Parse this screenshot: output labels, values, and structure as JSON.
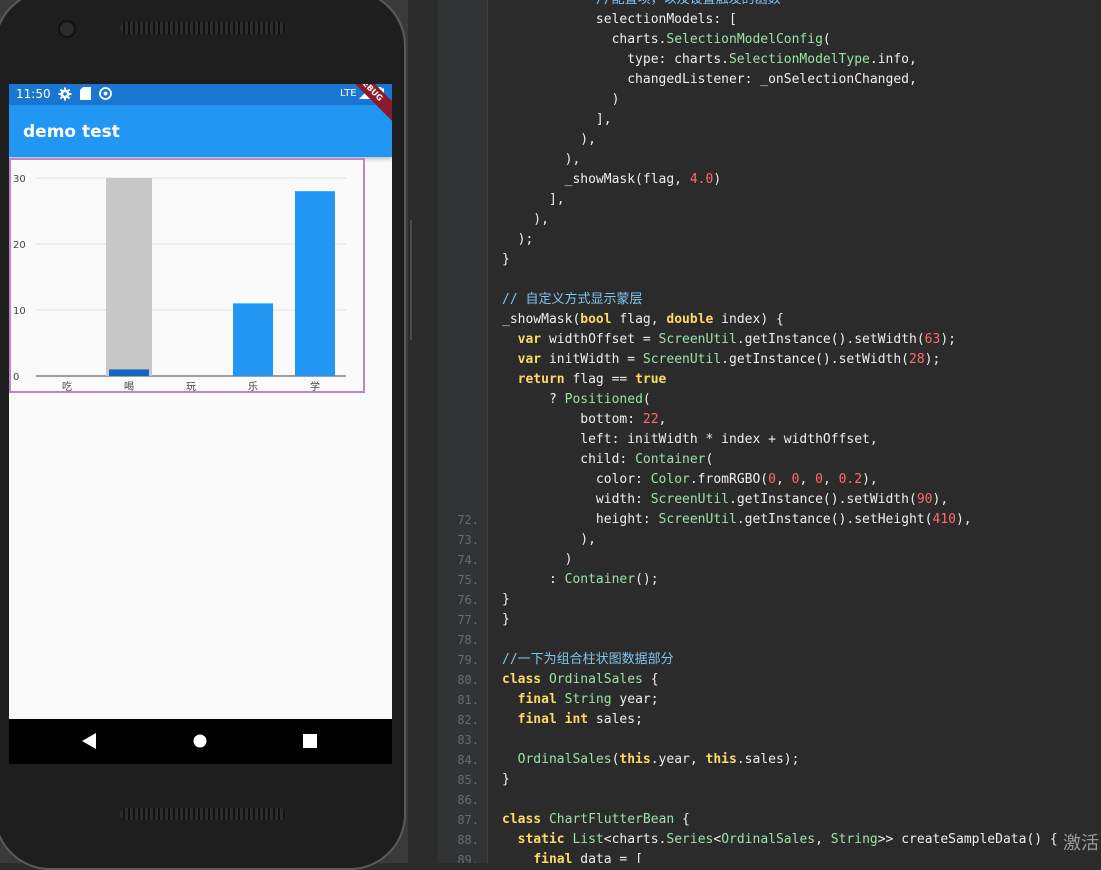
{
  "phone": {
    "status_time": "11:50",
    "network": "LTE",
    "app_title": "demo test",
    "debug_banner": "DEBUG",
    "colors": {
      "status_bar": "#1976d2",
      "app_bar": "#2196f3",
      "bar": "#2196f3",
      "highlight": "#c8c8c8"
    }
  },
  "chart_data": {
    "type": "bar",
    "categories": [
      "吃",
      "喝",
      "玩",
      "乐",
      "学"
    ],
    "values": [
      0,
      1,
      0,
      11,
      28
    ],
    "ylim": [
      0,
      30
    ],
    "yticks": [
      "0",
      "10",
      "20",
      "30"
    ],
    "grid": true,
    "highlight_index": 1,
    "highlight_value": 30
  },
  "emulator_panel": {
    "title_buttons": [
      "−",
      "×"
    ],
    "buttons": [
      "power-icon",
      "volume-up-icon",
      "volume-down-icon",
      "rotate-left-icon",
      "rotate-right-icon",
      "camera-icon",
      "zoom-icon",
      "back-icon",
      "home-icon",
      "overview-icon",
      "more-icon"
    ]
  },
  "code": {
    "lines": [
      {
        "n": "",
        "t": [
          [
            "cm",
            "            //配置项，以及设置触发的函数"
          ]
        ]
      },
      {
        "n": "",
        "t": [
          [
            "pl",
            "            selectionModels: ["
          ]
        ]
      },
      {
        "n": "",
        "t": [
          [
            "pl",
            "              charts."
          ],
          [
            "ty",
            "SelectionModelConfig"
          ],
          [
            "pl",
            "("
          ]
        ]
      },
      {
        "n": "",
        "t": [
          [
            "pl",
            "                type: charts."
          ],
          [
            "ty",
            "SelectionModelType"
          ],
          [
            "pl",
            ".info,"
          ]
        ]
      },
      {
        "n": "",
        "t": [
          [
            "pl",
            "                changedListener: _onSelectionChanged,"
          ]
        ]
      },
      {
        "n": "",
        "t": [
          [
            "pl",
            "              )"
          ]
        ]
      },
      {
        "n": "",
        "t": [
          [
            "pl",
            "            ],"
          ]
        ]
      },
      {
        "n": "",
        "t": [
          [
            "pl",
            "          ),"
          ]
        ]
      },
      {
        "n": "",
        "t": [
          [
            "pl",
            "        ),"
          ]
        ]
      },
      {
        "n": "",
        "t": [
          [
            "pl",
            "        _showMask(flag, "
          ],
          [
            "num",
            "4.0"
          ],
          [
            "pl",
            ")"
          ]
        ]
      },
      {
        "n": "",
        "t": [
          [
            "pl",
            "      ],"
          ]
        ]
      },
      {
        "n": "",
        "t": [
          [
            "pl",
            "    ),"
          ]
        ]
      },
      {
        "n": "",
        "t": [
          [
            "pl",
            "  );"
          ]
        ]
      },
      {
        "n": "",
        "t": [
          [
            "pl",
            "}"
          ]
        ]
      },
      {
        "n": "",
        "t": [
          [
            "pl",
            ""
          ]
        ]
      },
      {
        "n": "",
        "t": [
          [
            "cm",
            "// 自定义方式显示蒙层"
          ]
        ]
      },
      {
        "n": "",
        "t": [
          [
            "pl",
            "_showMask("
          ],
          [
            "kw",
            "bool"
          ],
          [
            "pl",
            " flag, "
          ],
          [
            "kw",
            "double"
          ],
          [
            "pl",
            " index) {"
          ]
        ]
      },
      {
        "n": "",
        "t": [
          [
            "pl",
            "  "
          ],
          [
            "kw",
            "var"
          ],
          [
            "pl",
            " widthOffset = "
          ],
          [
            "ty",
            "ScreenUtil"
          ],
          [
            "pl",
            ".getInstance().setWidth("
          ],
          [
            "num",
            "63"
          ],
          [
            "pl",
            ");"
          ]
        ]
      },
      {
        "n": "",
        "t": [
          [
            "pl",
            "  "
          ],
          [
            "kw",
            "var"
          ],
          [
            "pl",
            " initWidth = "
          ],
          [
            "ty",
            "ScreenUtil"
          ],
          [
            "pl",
            ".getInstance().setWidth("
          ],
          [
            "num",
            "28"
          ],
          [
            "pl",
            ");"
          ]
        ]
      },
      {
        "n": "",
        "t": [
          [
            "pl",
            "  "
          ],
          [
            "kw",
            "return"
          ],
          [
            "pl",
            " flag == "
          ],
          [
            "kw",
            "true"
          ]
        ]
      },
      {
        "n": "",
        "t": [
          [
            "pl",
            "      ? "
          ],
          [
            "ty",
            "Positioned"
          ],
          [
            "pl",
            "("
          ]
        ]
      },
      {
        "n": "",
        "t": [
          [
            "pl",
            "          bottom: "
          ],
          [
            "num",
            "22"
          ],
          [
            "pl",
            ","
          ]
        ]
      },
      {
        "n": "",
        "t": [
          [
            "pl",
            "          left: initWidth * index + widthOffset,"
          ]
        ]
      },
      {
        "n": "",
        "t": [
          [
            "pl",
            "          child: "
          ],
          [
            "ty",
            "Container"
          ],
          [
            "pl",
            "("
          ]
        ]
      },
      {
        "n": "",
        "t": [
          [
            "pl",
            "            color: "
          ],
          [
            "ty",
            "Color"
          ],
          [
            "pl",
            ".fromRGBO("
          ],
          [
            "num",
            "0"
          ],
          [
            "pl",
            ", "
          ],
          [
            "num",
            "0"
          ],
          [
            "pl",
            ", "
          ],
          [
            "num",
            "0"
          ],
          [
            "pl",
            ", "
          ],
          [
            "num",
            "0.2"
          ],
          [
            "pl",
            "),"
          ]
        ]
      },
      {
        "n": "",
        "t": [
          [
            "pl",
            "            width: "
          ],
          [
            "ty",
            "ScreenUtil"
          ],
          [
            "pl",
            ".getInstance().setWidth("
          ],
          [
            "num",
            "90"
          ],
          [
            "pl",
            "),"
          ]
        ]
      },
      {
        "n": "72.",
        "t": [
          [
            "pl",
            "            height: "
          ],
          [
            "ty",
            "ScreenUtil"
          ],
          [
            "pl",
            ".getInstance().setHeight("
          ],
          [
            "num",
            "410"
          ],
          [
            "pl",
            "),"
          ]
        ]
      },
      {
        "n": "73.",
        "t": [
          [
            "pl",
            "          ),"
          ]
        ]
      },
      {
        "n": "74.",
        "t": [
          [
            "pl",
            "        )"
          ]
        ]
      },
      {
        "n": "75.",
        "t": [
          [
            "pl",
            "      : "
          ],
          [
            "ty",
            "Container"
          ],
          [
            "pl",
            "();"
          ]
        ]
      },
      {
        "n": "76.",
        "t": [
          [
            "pl",
            "}"
          ]
        ]
      },
      {
        "n": "77.",
        "t": [
          [
            "pl",
            "}"
          ]
        ]
      },
      {
        "n": "78.",
        "t": [
          [
            "pl",
            ""
          ]
        ]
      },
      {
        "n": "79.",
        "t": [
          [
            "cm",
            "//一下为组合柱状图数据部分"
          ]
        ]
      },
      {
        "n": "80.",
        "t": [
          [
            "kw",
            "class"
          ],
          [
            "pl",
            " "
          ],
          [
            "ty",
            "OrdinalSales"
          ],
          [
            "pl",
            " {"
          ]
        ]
      },
      {
        "n": "81.",
        "t": [
          [
            "pl",
            "  "
          ],
          [
            "kw",
            "final"
          ],
          [
            "pl",
            " "
          ],
          [
            "ty",
            "String"
          ],
          [
            "pl",
            " year;"
          ]
        ]
      },
      {
        "n": "82.",
        "t": [
          [
            "pl",
            "  "
          ],
          [
            "kw",
            "final"
          ],
          [
            "pl",
            " "
          ],
          [
            "kw",
            "int"
          ],
          [
            "pl",
            " sales;"
          ]
        ]
      },
      {
        "n": "83.",
        "t": [
          [
            "pl",
            ""
          ]
        ]
      },
      {
        "n": "84.",
        "t": [
          [
            "pl",
            "  "
          ],
          [
            "ty",
            "OrdinalSales"
          ],
          [
            "pl",
            "("
          ],
          [
            "kw",
            "this"
          ],
          [
            "pl",
            ".year, "
          ],
          [
            "kw",
            "this"
          ],
          [
            "pl",
            ".sales);"
          ]
        ]
      },
      {
        "n": "85.",
        "t": [
          [
            "pl",
            "}"
          ]
        ]
      },
      {
        "n": "86.",
        "t": [
          [
            "pl",
            ""
          ]
        ]
      },
      {
        "n": "87.",
        "t": [
          [
            "kw",
            "class"
          ],
          [
            "pl",
            " "
          ],
          [
            "ty",
            "ChartFlutterBean"
          ],
          [
            "pl",
            " {"
          ]
        ]
      },
      {
        "n": "88.",
        "t": [
          [
            "pl",
            "  "
          ],
          [
            "kw",
            "static"
          ],
          [
            "pl",
            " "
          ],
          [
            "ty",
            "List"
          ],
          [
            "pl",
            "<charts."
          ],
          [
            "ty",
            "Series"
          ],
          [
            "pl",
            "<"
          ],
          [
            "ty",
            "OrdinalSales"
          ],
          [
            "pl",
            ", "
          ],
          [
            "ty",
            "String"
          ],
          [
            "pl",
            ">> createSampleData() {"
          ]
        ]
      },
      {
        "n": "89.",
        "t": [
          [
            "pl",
            "    "
          ],
          [
            "kw",
            "final"
          ],
          [
            "pl",
            " data = ["
          ]
        ]
      }
    ],
    "watermark": "激活"
  }
}
